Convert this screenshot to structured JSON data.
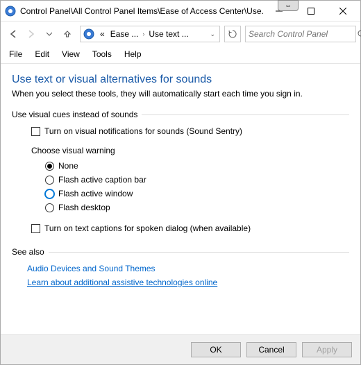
{
  "window": {
    "title": "Control Panel\\All Control Panel Items\\Ease of Access Center\\Use..."
  },
  "breadcrumb": {
    "seg0": "«",
    "seg1": "Ease ...",
    "seg2": "Use text ..."
  },
  "search": {
    "placeholder": "Search Control Panel"
  },
  "menu": {
    "file": "File",
    "edit": "Edit",
    "view": "View",
    "tools": "Tools",
    "help": "Help"
  },
  "page": {
    "title": "Use text or visual alternatives for sounds",
    "subtitle": "When you select these tools, they will automatically start each time you sign in."
  },
  "group1": {
    "label": "Use visual cues instead of sounds",
    "chk1": "Turn on visual notifications for sounds (Sound Sentry)",
    "sub": "Choose visual warning",
    "r0": "None",
    "r1": "Flash active caption bar",
    "r2": "Flash active window",
    "r3": "Flash desktop",
    "chk2": "Turn on text captions for spoken dialog (when available)"
  },
  "seealso": {
    "label": "See also",
    "link1": "Audio Devices and Sound Themes",
    "link2": "Learn about additional assistive technologies online"
  },
  "buttons": {
    "ok": "OK",
    "cancel": "Cancel",
    "apply": "Apply"
  }
}
